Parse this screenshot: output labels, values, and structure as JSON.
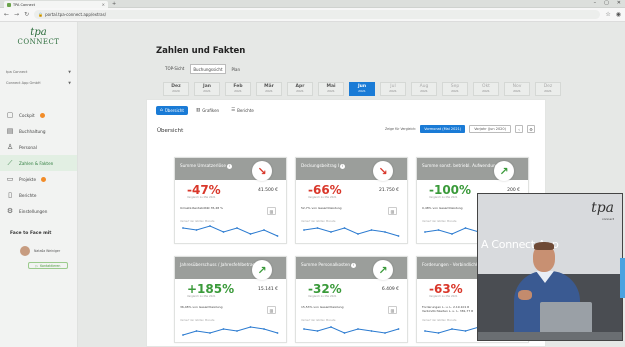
{
  "browser": {
    "tab_title": "TPA Connect",
    "tab_close": "×",
    "new_tab": "+",
    "url": "portal.tpa-connect.app/extras/",
    "win_min": "–",
    "win_max": "▢",
    "win_close": "✕"
  },
  "sidebar": {
    "logo_mark": "tpa",
    "logo_text": "CONNECT",
    "client_select": "tpa Connect",
    "company_select": "Connect App GmbH",
    "items": [
      {
        "label": "Cockpit",
        "icon": "cockpit-icon",
        "badge": true
      },
      {
        "label": "Buchhaltung",
        "icon": "book-icon",
        "badge": false
      },
      {
        "label": "Personal",
        "icon": "people-icon",
        "badge": false
      },
      {
        "label": "Zahlen & Fakten",
        "icon": "chart-line-icon",
        "badge": false,
        "active": true
      },
      {
        "label": "Projekte",
        "icon": "folder-icon",
        "badge": true
      },
      {
        "label": "Berichte",
        "icon": "document-icon",
        "badge": false
      },
      {
        "label": "Einstellungen",
        "icon": "gear-icon",
        "badge": false
      }
    ],
    "face_to_face_title": "Face to Face mit",
    "contact_name": "Nataša Weiniger",
    "contact_button": "Kontaktieren"
  },
  "page": {
    "title": "Zahlen und Fakten",
    "subtabs": [
      "TOP-Sicht",
      "Buchungssicht",
      "Plan"
    ],
    "months": [
      {
        "m": "Dez",
        "y": "2020"
      },
      {
        "m": "Jan",
        "y": "2021"
      },
      {
        "m": "Feb",
        "y": "2021"
      },
      {
        "m": "Mär",
        "y": "2021"
      },
      {
        "m": "Apr",
        "y": "2021"
      },
      {
        "m": "Mai",
        "y": "2021"
      },
      {
        "m": "Jun",
        "y": "2021"
      },
      {
        "m": "Jul",
        "y": "2021"
      },
      {
        "m": "Aug",
        "y": "2021"
      },
      {
        "m": "Sep",
        "y": "2021"
      },
      {
        "m": "Okt",
        "y": "2021"
      },
      {
        "m": "Nov",
        "y": "2021"
      },
      {
        "m": "Dez",
        "y": "2021"
      }
    ],
    "active_month_index": 6,
    "view_tabs": [
      "Übersicht",
      "Grafiken",
      "Berichte"
    ],
    "overview_title": "Übersicht",
    "compare_label": "Zeige für Vergleich:",
    "compare_a": "Vormonat (Mai 2021)",
    "compare_b": "Vorjahr (Jun 2020)",
    "compare_prev": "‹",
    "compare_gear": "⚙"
  },
  "cards": [
    {
      "title": "Summe Umsatzerlöse",
      "pct": "-47%",
      "sub": "Vergleich zu Mai 2021",
      "amount": "41.500 €",
      "note": "Umsatz-Rentabilität 35,48 %",
      "dir": "down",
      "trend": "Verlauf der letzten Monate"
    },
    {
      "title": "Deckungsbeitrag I",
      "pct": "-66%",
      "sub": "Vergleich zu Mai 2021",
      "amount": "21.750 €",
      "note": "52,7% von Gesamtleistung",
      "dir": "down",
      "trend": "Verlauf der letzten Monate"
    },
    {
      "title": "Summe sonst. betriebl. Aufwendungen",
      "pct": "-100%",
      "sub": "Vergleich zu Mai 2021",
      "amount": "200 €",
      "note": "0,48% von Gesamtleistung",
      "dir": "up",
      "trend": "Verlauf der letzten Monate"
    },
    {
      "title": "Jahresüberschuss / Jahresfehlbetrag",
      "pct": "+185%",
      "sub": "Vergleich zu Mai 2021",
      "amount": "15.141 €",
      "note": "36,48% von Gesamtleistung",
      "dir": "up",
      "trend": "Verlauf der letzten Monate"
    },
    {
      "title": "Summe Personalkosten",
      "pct": "-32%",
      "sub": "Vergleich zu Mai 2021",
      "amount": "6.409 €",
      "note": "15,53% von Gesamtleistung",
      "dir": "up",
      "trend": "Verlauf der letzten Monate"
    },
    {
      "title": "Forderungen - Verbindlichkeiten",
      "pct": "-63%",
      "sub": "Vergleich zu Mai 2021",
      "amount": "",
      "note": "Forderungen L. u. L. 2.19.101 €",
      "note2": "Verbindlichkeiten L. u. L. 381,77 €",
      "dir": "down",
      "trend": "Verlauf der letzten Monate"
    }
  ],
  "video": {
    "brand": "tpa",
    "brand_sub": "connect",
    "caption": "A Connect App"
  }
}
